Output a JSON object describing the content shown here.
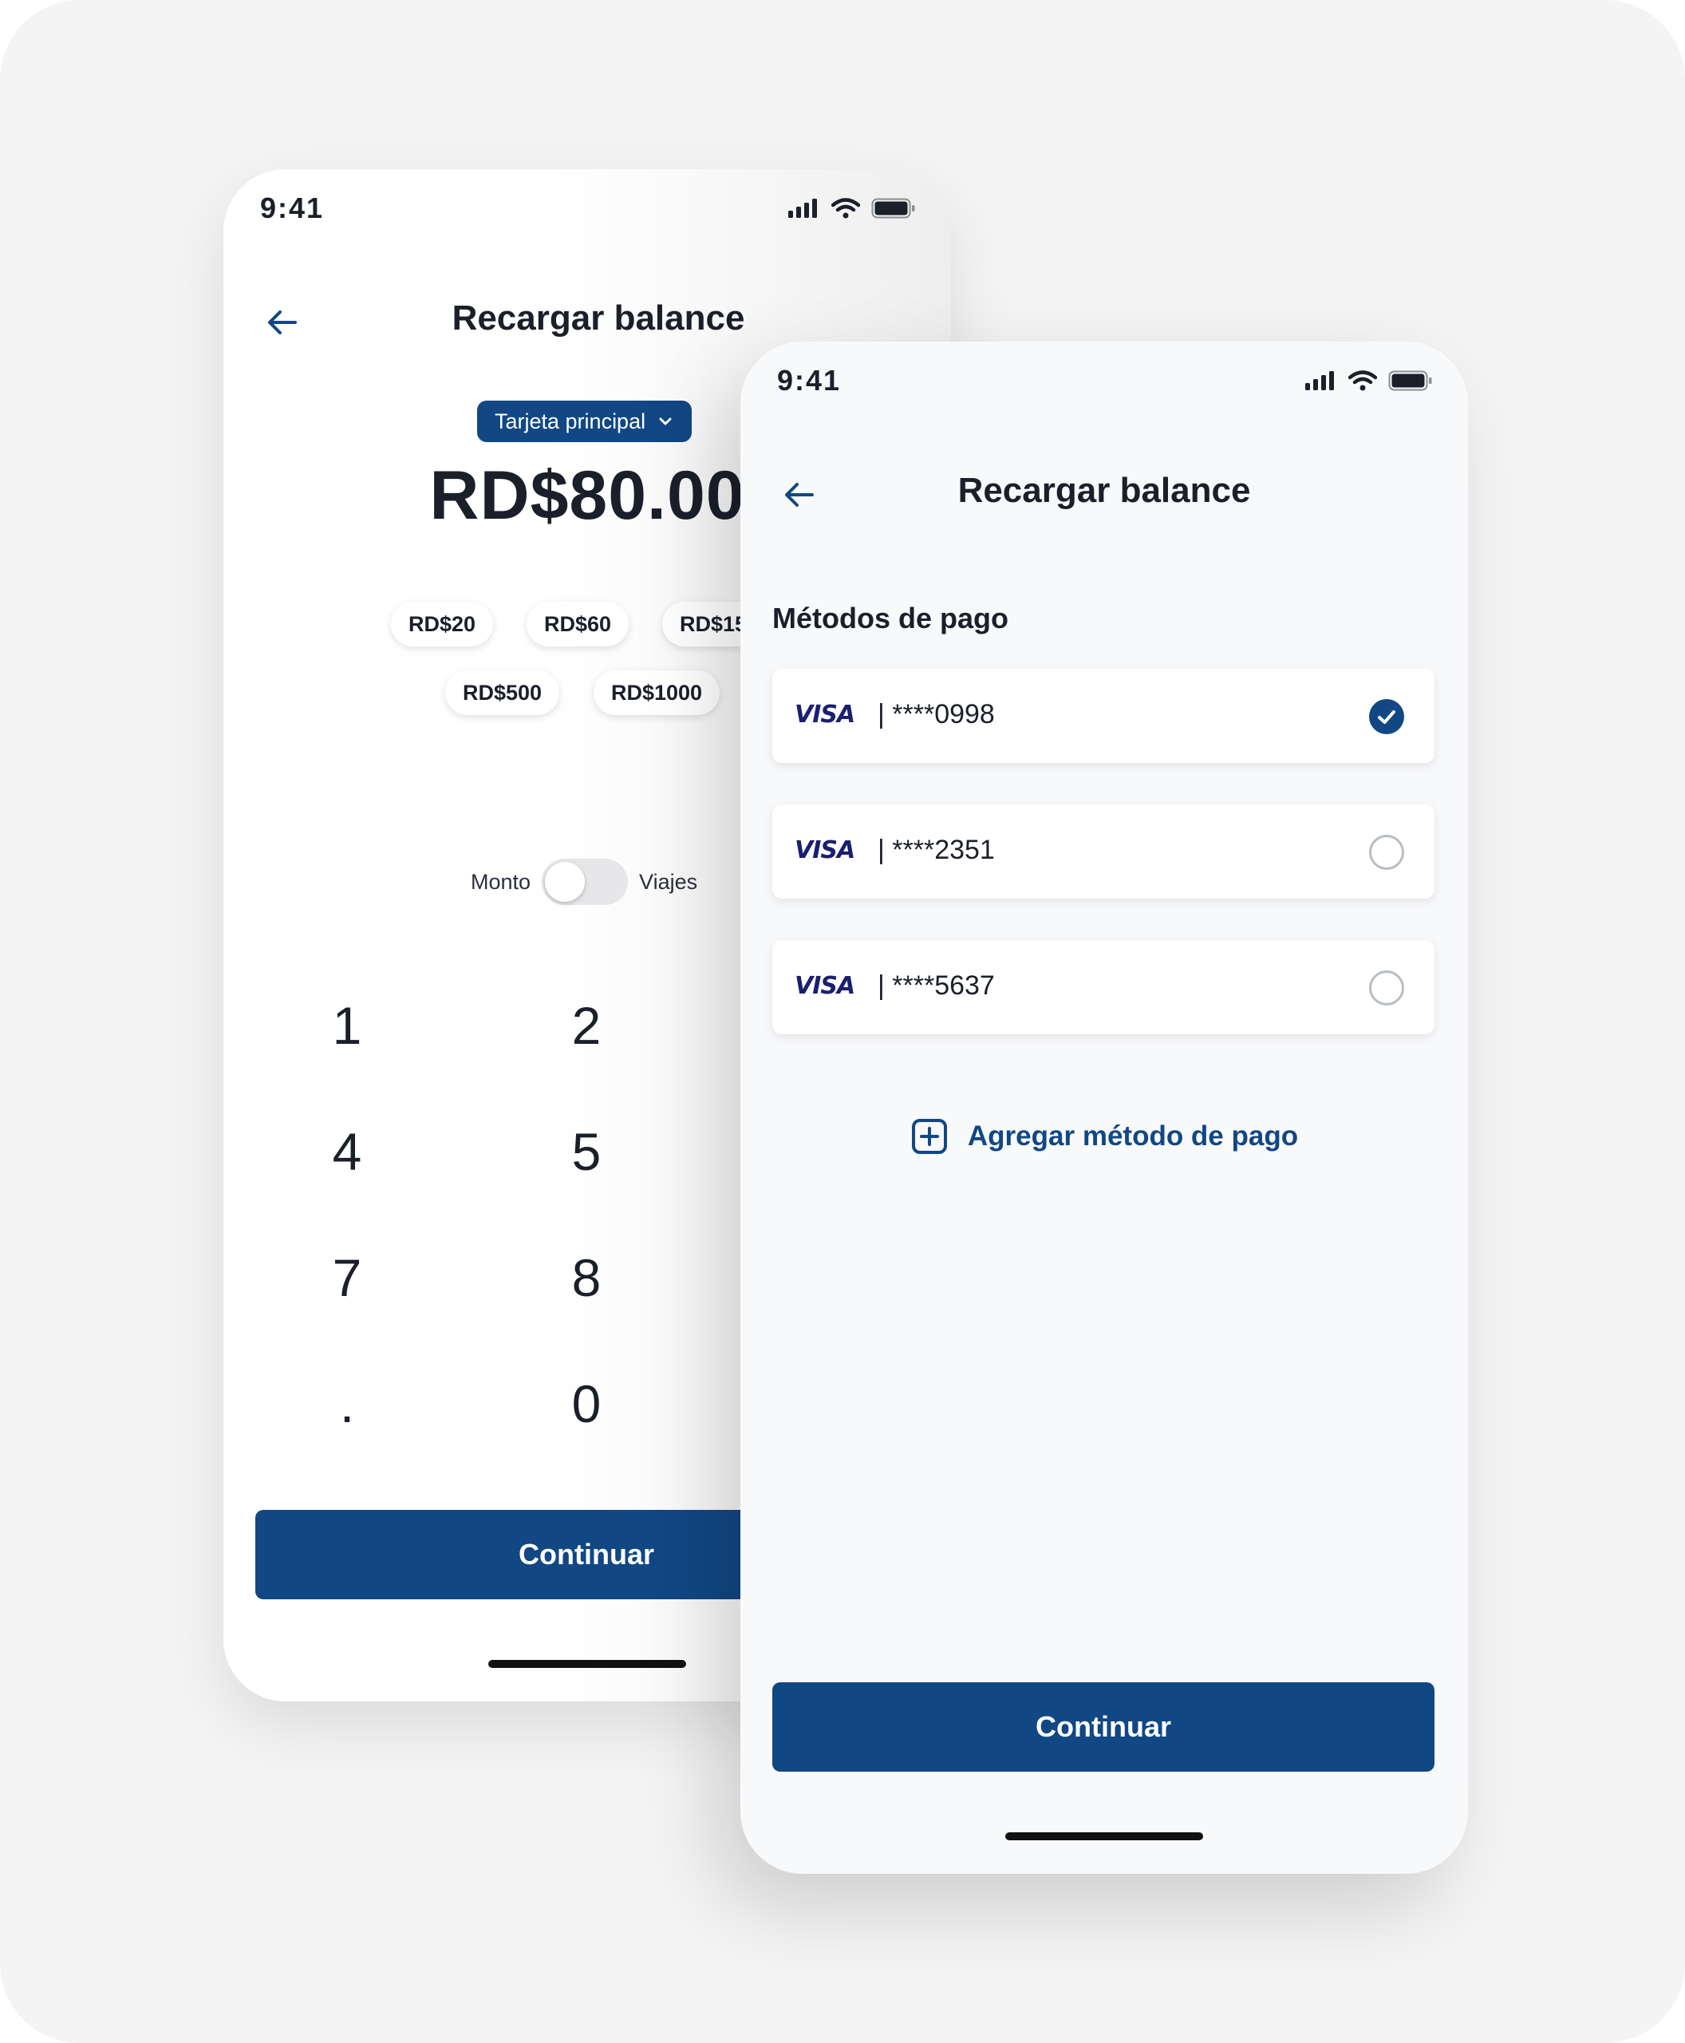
{
  "screens": {
    "amount": {
      "status_time": "9:41",
      "title": "Recargar balance",
      "card_selector": "Tarjeta principal",
      "amount": "RD$80.00",
      "chips": [
        "RD$20",
        "RD$60",
        "RD$15",
        "RD$500",
        "RD$1000"
      ],
      "toggle": {
        "left_label": "Monto",
        "right_label": "Viajes"
      },
      "keypad": [
        "1",
        "2",
        "4",
        "5",
        "7",
        "8",
        ".",
        "0"
      ],
      "continue_label": "Continuar"
    },
    "payment": {
      "status_time": "9:41",
      "title": "Recargar balance",
      "section_title": "Métodos de pago",
      "methods": [
        {
          "brand": "VISA",
          "number": "| ****0998",
          "selected": true
        },
        {
          "brand": "VISA",
          "number": "| ****2351",
          "selected": false
        },
        {
          "brand": "VISA",
          "number": "| ****5637",
          "selected": false
        }
      ],
      "add_label": "Agregar método de pago",
      "continue_label": "Continuar"
    }
  },
  "colors": {
    "primary": "#114783",
    "visa": "#1a1f71",
    "background": "#f4f4f5"
  },
  "icons": [
    "back-arrow-icon",
    "signal-icon",
    "wifi-icon",
    "battery-icon",
    "chevron-down-icon",
    "check-icon",
    "plus-square-icon"
  ]
}
